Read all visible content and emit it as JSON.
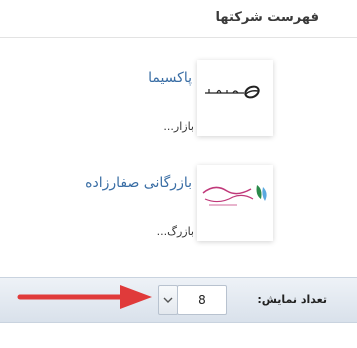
{
  "widget": {
    "title": "فهرست شرکتها"
  },
  "companies": [
    {
      "name": "پاکسیما",
      "description": "بازار...",
      "logo_text": "پاکسیما"
    },
    {
      "name": "بازرگانی صفارزاده",
      "description": "بازرگ...",
      "logo_text": "بازرگانی صفارزاده"
    }
  ],
  "pager": {
    "label": "تعداد نمایش:",
    "page_size": "8"
  },
  "colors": {
    "link": "#3a6ea5",
    "arrow": "#e03a3a",
    "bar": "#dde4ed"
  },
  "icons": {
    "dropdown": "chevron-down-icon",
    "annotation": "red-arrow-icon"
  }
}
